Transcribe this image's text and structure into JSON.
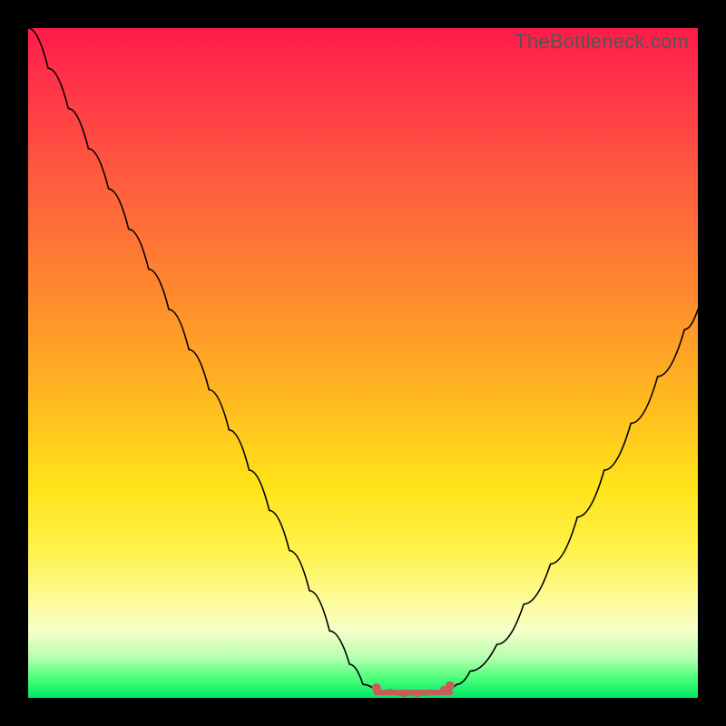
{
  "watermark": "TheBottleneck.com",
  "colors": {
    "frame": "#000000",
    "curve": "#000000",
    "marker": "#c95b5b",
    "gradient_top": "#ff1a4a",
    "gradient_bottom": "#00e865"
  },
  "chart_data": {
    "type": "line",
    "title": "",
    "xlabel": "",
    "ylabel": "",
    "xlim": [
      0,
      100
    ],
    "ylim": [
      0,
      100
    ],
    "x": [
      0,
      3,
      6,
      9,
      12,
      15,
      18,
      21,
      24,
      27,
      30,
      33,
      36,
      39,
      42,
      45,
      48,
      50,
      52,
      55,
      58,
      60,
      62,
      64,
      66,
      70,
      74,
      78,
      82,
      86,
      90,
      94,
      98,
      100
    ],
    "y": [
      100,
      94,
      88,
      82,
      76,
      70,
      64,
      58,
      52,
      46,
      40,
      34,
      28,
      22,
      16,
      10,
      5,
      2,
      1,
      0.5,
      0.5,
      0.5,
      1,
      2,
      4,
      8,
      14,
      20,
      27,
      34,
      41,
      48,
      55,
      58
    ],
    "flat_region_x": [
      52,
      63
    ],
    "markers": [
      {
        "x": 52,
        "y": 1.5
      },
      {
        "x": 54,
        "y": 0.9
      },
      {
        "x": 56,
        "y": 0.6
      },
      {
        "x": 58,
        "y": 0.6
      },
      {
        "x": 60,
        "y": 0.8
      },
      {
        "x": 62,
        "y": 1.3
      },
      {
        "x": 63,
        "y": 1.8
      }
    ],
    "annotations": []
  }
}
